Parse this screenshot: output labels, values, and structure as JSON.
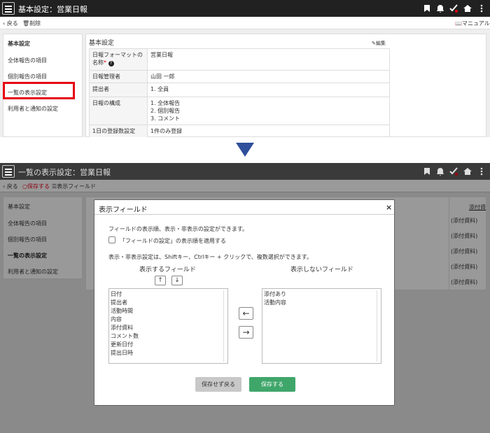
{
  "top": {
    "header_title": "基本設定：営業日報",
    "back": "戻る",
    "delete": "削除",
    "manual": "マニュアル",
    "sidebar": [
      "基本設定",
      "全体報告の項目",
      "個別報告の項目",
      "一覧の表示設定",
      "利用者と通知の設定"
    ],
    "section_title": "基本設定",
    "edit": "編集",
    "rows": [
      {
        "key": "日報フォーマットの名称",
        "required": "*",
        "help": "?",
        "val": [
          "営業日報"
        ]
      },
      {
        "key": "日報管理者",
        "val": [
          "山田 一郎"
        ]
      },
      {
        "key": "提出者",
        "val": [
          "1. 全員"
        ]
      },
      {
        "key": "日報の構成",
        "val": [
          "1. 全体報告",
          "2. 個別報告",
          "3. コメント"
        ]
      },
      {
        "key": "1日の登録数設定",
        "val": [
          "1件のみ登録"
        ]
      }
    ]
  },
  "bottom": {
    "header_title": "一覧の表示設定：営業日報",
    "back": "戻る",
    "save": "保存する",
    "display_field": "表示フィールド",
    "sidebar": [
      "基本設定",
      "全体報告の項目",
      "個別報告の項目",
      "一覧の表示設定",
      "利用者と通知の設定"
    ],
    "bg_col_header": "添付資",
    "bg_cells": [
      "(添付資料)",
      "(添付資料)",
      "(添付資料)",
      "(添付資料)",
      "(添付資料)"
    ],
    "modal": {
      "title": "表示フィールド",
      "close": "×",
      "desc": "フィールドの表示順、表示・非表示の設定ができます。",
      "checkbox_label": "「フィールドの設定」の表示順を適用する",
      "hint": "表示・非表示設定は、Shiftキー、Ctrlキー + クリックで、複数選択ができます。",
      "shown_label": "表示するフィールド",
      "hidden_label": "表示しないフィールド",
      "shown_fields": [
        "日付",
        "提出者",
        "活動時間",
        "内容",
        "添付資料",
        "コメント数",
        "更新日付",
        "提出日時"
      ],
      "hidden_fields": [
        "添付あり",
        "活動内容"
      ],
      "up": "↑",
      "down": "↓",
      "left": "←",
      "right": "→",
      "cancel_btn": "保存せず戻る",
      "save_btn": "保存する"
    }
  },
  "colors": {
    "header": "#212121",
    "accent": "#3fa66a",
    "highlight": "#e60012",
    "arrow": "#2f4e9b",
    "required": "#e60012"
  }
}
